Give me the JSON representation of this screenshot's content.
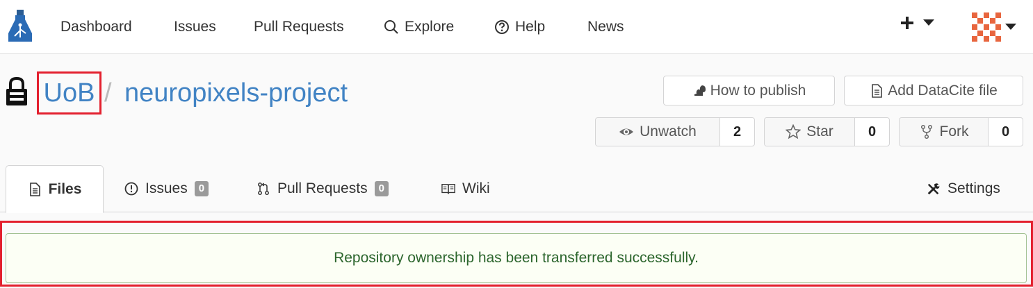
{
  "nav": {
    "items": [
      {
        "label": "Dashboard"
      },
      {
        "label": "Issues"
      },
      {
        "label": "Pull Requests"
      },
      {
        "label": "Explore",
        "icon": "search-icon"
      },
      {
        "label": "Help",
        "icon": "help-circle-icon"
      },
      {
        "label": "News"
      }
    ]
  },
  "repo": {
    "owner": "UoB",
    "separator": "/",
    "name": "neuropixels-project",
    "buttons": {
      "publish": "How to publish",
      "datacite": "Add DataCite file"
    },
    "watch": {
      "label": "Unwatch",
      "count": "2"
    },
    "star": {
      "label": "Star",
      "count": "0"
    },
    "fork": {
      "label": "Fork",
      "count": "0"
    }
  },
  "tabs": {
    "files": "Files",
    "issues": {
      "label": "Issues",
      "count": "0"
    },
    "pulls": {
      "label": "Pull Requests",
      "count": "0"
    },
    "wiki": "Wiki",
    "settings": "Settings"
  },
  "flash": {
    "message": "Repository ownership has been transferred successfully."
  },
  "colors": {
    "link": "#4183c4",
    "highlight": "#e3202e",
    "success_text": "#2c662d",
    "success_bg": "#fcfff5"
  }
}
